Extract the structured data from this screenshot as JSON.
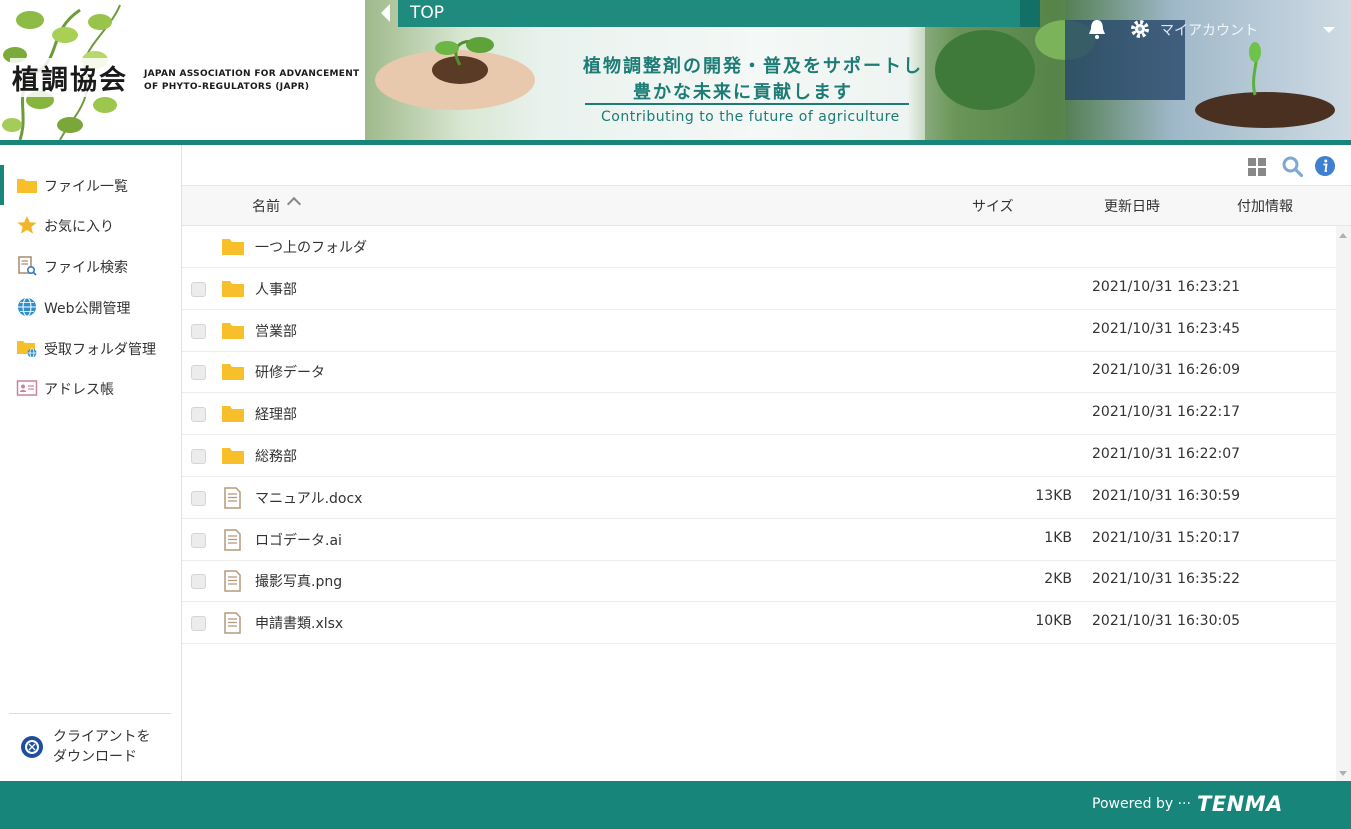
{
  "header": {
    "logo_title": "植調協会",
    "logo_subtitle": "JAPAN ASSOCIATION FOR ADVANCEMENT OF PHYTO-REGULATORS (JAPR)",
    "banner_line1": "植物調整剤の開発・普及をサポートし",
    "banner_line2": "豊かな未来に貢献します",
    "banner_en": "Contributing to the future of agriculture",
    "breadcrumb": "TOP",
    "account_label": "マイアカウント"
  },
  "sidebar": {
    "items": [
      {
        "label": "ファイル一覧",
        "icon": "folder-icon"
      },
      {
        "label": "お気に入り",
        "icon": "star-icon"
      },
      {
        "label": "ファイル検索",
        "icon": "file-search-icon"
      },
      {
        "label": "Web公開管理",
        "icon": "globe-icon"
      },
      {
        "label": "受取フォルダ管理",
        "icon": "inbox-folder-icon"
      },
      {
        "label": "アドレス帳",
        "icon": "address-book-icon"
      }
    ],
    "client_download_line1": "クライアントを",
    "client_download_line2": "ダウンロード"
  },
  "columns": {
    "name": "名前",
    "size": "サイズ",
    "modified": "更新日時",
    "extra": "付加情報"
  },
  "files": {
    "parent_folder": "一つ上のフォルダ",
    "rows": [
      {
        "name": "人事部",
        "type": "folder",
        "size": "",
        "date": "2021/10/31 16:23:21"
      },
      {
        "name": "営業部",
        "type": "folder",
        "size": "",
        "date": "2021/10/31 16:23:45"
      },
      {
        "name": "研修データ",
        "type": "folder",
        "size": "",
        "date": "2021/10/31 16:26:09"
      },
      {
        "name": "経理部",
        "type": "folder",
        "size": "",
        "date": "2021/10/31 16:22:17"
      },
      {
        "name": "総務部",
        "type": "folder",
        "size": "",
        "date": "2021/10/31 16:22:07"
      },
      {
        "name": "マニュアル.docx",
        "type": "file",
        "size": "13KB",
        "date": "2021/10/31 16:30:59"
      },
      {
        "name": "ロゴデータ.ai",
        "type": "file",
        "size": "1KB",
        "date": "2021/10/31 15:20:17"
      },
      {
        "name": "撮影写真.png",
        "type": "file",
        "size": "2KB",
        "date": "2021/10/31 16:35:22"
      },
      {
        "name": "申請書類.xlsx",
        "type": "file",
        "size": "10KB",
        "date": "2021/10/31 16:30:05"
      }
    ]
  },
  "footer": {
    "powered_by": "Powered by ···",
    "brand": "TENMA"
  },
  "colors": {
    "accent": "#17857a",
    "folder": "#f7bf2a"
  }
}
